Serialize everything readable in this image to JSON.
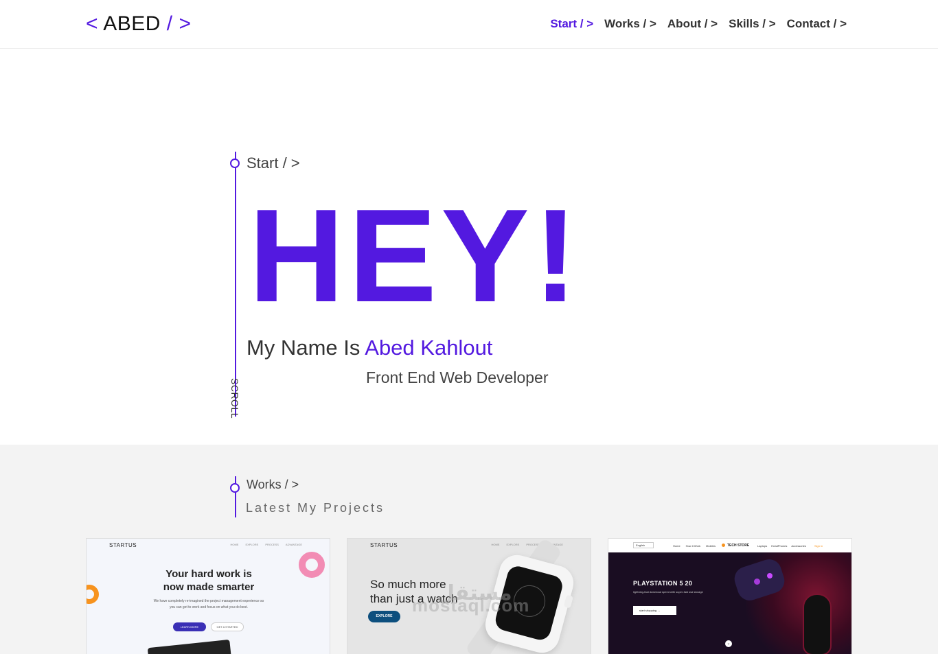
{
  "header": {
    "logo": {
      "open": "<",
      "name": "ABED",
      "slash": "/",
      "close": ">"
    },
    "nav": [
      {
        "label": "Start / >",
        "active": true
      },
      {
        "label": "Works / >",
        "active": false
      },
      {
        "label": "About / >",
        "active": false
      },
      {
        "label": "Skills / >",
        "active": false
      },
      {
        "label": "Contact / >",
        "active": false
      }
    ]
  },
  "hero": {
    "section_label": "Start / >",
    "headline": "HEY!",
    "intro_prefix": "My Name Is ",
    "intro_name": "Abed Kahlout",
    "role": "Front End Web Developer",
    "scroll_label": "SCROLL"
  },
  "works": {
    "section_label": "Works / >",
    "subtitle": "Latest My Projects",
    "projects": [
      {
        "brand": "STARTUS",
        "nav": [
          "HOME",
          "EXPLORE",
          "PROCESS",
          "ADVANTAGE"
        ],
        "title_line1": "Your hard work is",
        "title_line2": "now made smarter",
        "text": "We have completely re-imagined the project management experience so you can get to work and focus on what you do best.",
        "primary_button": "LEARN MORE",
        "secondary_button": "GET A STARTED"
      },
      {
        "brand": "STARTUS",
        "nav": [
          "HOME",
          "EXPLORE",
          "PROCESS",
          "ADVANTAGE"
        ],
        "title_line1": "So much more",
        "title_line2": "than just a watch",
        "button": "EXPLORE",
        "watermark": "mostaql.com",
        "watermark_ar": "مستقل"
      },
      {
        "lang": "English",
        "links": [
          "Home",
          "How it Work",
          "Mobiles"
        ],
        "store": "TECH STORE",
        "links2": [
          "Laptops",
          "HeadPhones",
          "Accessories"
        ],
        "signin": "Sign in",
        "title": "PLAYSTATION 5 20",
        "text": "lightning-fast download speed with super-fast ssd storage",
        "button": "start shopping  →",
        "arrow": "⌄"
      }
    ]
  },
  "colors": {
    "accent": "#5319e0",
    "text": "#333333",
    "section_bg": "#f3f3f3"
  }
}
